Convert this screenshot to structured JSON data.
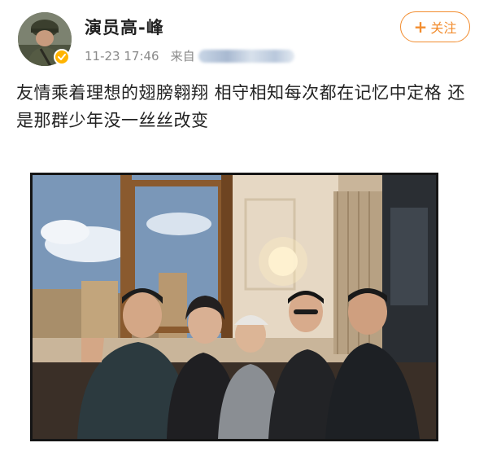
{
  "post": {
    "author": {
      "name": "演员高-峰",
      "avatar_icon": "avatar-soldier-helmet",
      "verified_icon": "verified-badge-icon"
    },
    "meta": {
      "time": "11-23 17:46",
      "source_prefix": "来自"
    },
    "follow_button": {
      "label": "关注",
      "icon": "plus-icon",
      "color": "#f28d2f"
    },
    "text": "友情乘着理想的翅膀翱翔 相守相知每次都在记忆中定格 还是那群少年没一丝丝改变",
    "photo": {
      "people_count": 5
    }
  }
}
